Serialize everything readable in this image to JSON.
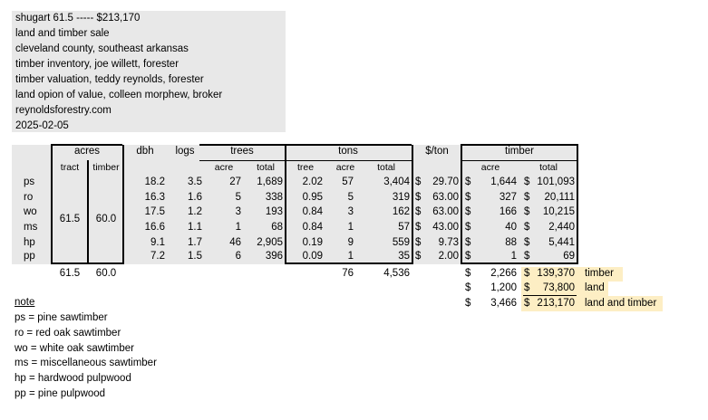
{
  "header": {
    "lines": [
      "shugart 61.5 ----- $213,170",
      "land and timber sale",
      "cleveland county, southeast arkansas",
      "timber inventory, joe willett, forester",
      "timber valuation, teddy reynolds, forester",
      "land opion of value, colleen morphew, broker",
      "reynoldsforestry.com",
      "2025-02-05"
    ]
  },
  "table": {
    "groups": {
      "acres": "acres",
      "dbh": "dbh",
      "logs": "logs",
      "trees": "trees",
      "tons": "tons",
      "per_ton": "$/ton",
      "timber": "timber"
    },
    "sub": {
      "tract": "tract",
      "timber": "timber",
      "trees_acre": "acre",
      "trees_total": "total",
      "tons_tree": "tree",
      "tons_acre": "acre",
      "tons_total": "total",
      "timber_acre": "acre",
      "timber_total": "total"
    },
    "merged": {
      "tract": "61.5",
      "timber": "60.0"
    },
    "rows": [
      {
        "label": "ps",
        "dbh": "18.2",
        "logs": "3.5",
        "trees_acre": "27",
        "trees_total": "1,689",
        "tons_tree": "2.02",
        "tons_acre": "57",
        "tons_total": "3,404",
        "price_sym": "$",
        "price": "29.70",
        "t_acre_sym": "$",
        "t_acre": "1,644",
        "t_total_sym": "$",
        "t_total": "101,093"
      },
      {
        "label": "ro",
        "dbh": "16.3",
        "logs": "1.6",
        "trees_acre": "5",
        "trees_total": "338",
        "tons_tree": "0.95",
        "tons_acre": "5",
        "tons_total": "319",
        "price_sym": "$",
        "price": "63.00",
        "t_acre_sym": "$",
        "t_acre": "327",
        "t_total_sym": "$",
        "t_total": "20,111"
      },
      {
        "label": "wo",
        "dbh": "17.5",
        "logs": "1.2",
        "trees_acre": "3",
        "trees_total": "193",
        "tons_tree": "0.84",
        "tons_acre": "3",
        "tons_total": "162",
        "price_sym": "$",
        "price": "63.00",
        "t_acre_sym": "$",
        "t_acre": "166",
        "t_total_sym": "$",
        "t_total": "10,215"
      },
      {
        "label": "ms",
        "dbh": "16.6",
        "logs": "1.1",
        "trees_acre": "1",
        "trees_total": "68",
        "tons_tree": "0.84",
        "tons_acre": "1",
        "tons_total": "57",
        "price_sym": "$",
        "price": "43.00",
        "t_acre_sym": "$",
        "t_acre": "40",
        "t_total_sym": "$",
        "t_total": "2,440"
      },
      {
        "label": "hp",
        "dbh": "9.1",
        "logs": "1.7",
        "trees_acre": "46",
        "trees_total": "2,905",
        "tons_tree": "0.19",
        "tons_acre": "9",
        "tons_total": "559",
        "price_sym": "$",
        "price": "9.73",
        "t_acre_sym": "$",
        "t_acre": "88",
        "t_total_sym": "$",
        "t_total": "5,441"
      },
      {
        "label": "pp",
        "dbh": "7.2",
        "logs": "1.5",
        "trees_acre": "6",
        "trees_total": "396",
        "tons_tree": "0.09",
        "tons_acre": "1",
        "tons_total": "35",
        "price_sym": "$",
        "price": "2.00",
        "t_acre_sym": "$",
        "t_acre": "1",
        "t_total_sym": "$",
        "t_total": "69"
      }
    ],
    "totals": {
      "tract": "61.5",
      "timber": "60.0",
      "tons_acre": "76",
      "tons_total": "4,536"
    },
    "summary": [
      {
        "sym1": "$",
        "acre": "2,266",
        "sym2": "$",
        "total": "139,370",
        "label": "timber"
      },
      {
        "sym1": "$",
        "acre": "1,200",
        "sym2": "$",
        "total": "73,800",
        "label": "land"
      },
      {
        "sym1": "$",
        "acre": "3,466",
        "sym2": "$",
        "total": "213,170",
        "label": "land and timber"
      }
    ]
  },
  "notes": {
    "title": "note",
    "lines": [
      "ps = pine sawtimber",
      "ro = red oak sawtimber",
      "wo = white oak sawtimber",
      "ms = miscellaneous sawtimber",
      "hp = hardwood pulpwood",
      "pp = pine pulpwood"
    ]
  },
  "colors": {
    "panel": "#e8e8e8",
    "highlight": "#fdeec4",
    "text": "#000000"
  }
}
